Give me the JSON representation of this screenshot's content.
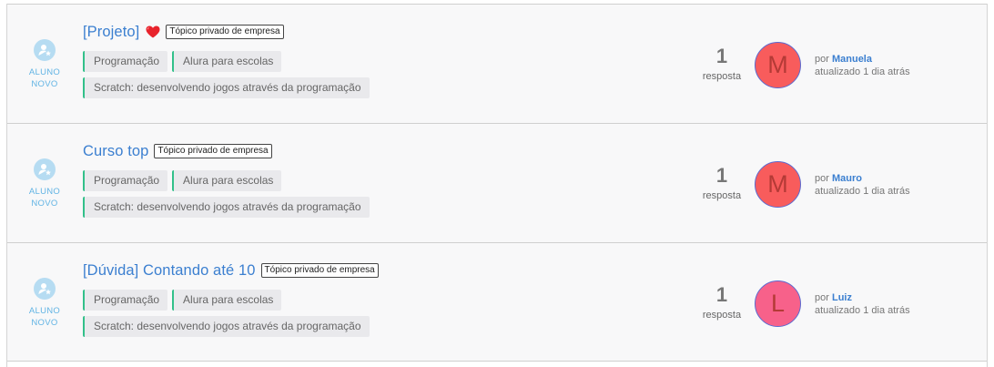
{
  "topics": [
    {
      "title": "[Projeto]",
      "has_heart": true,
      "badge": "Tópico privado de empresa",
      "author_type": [
        "ALUNO",
        "NOVO"
      ],
      "tags_row1": [
        "Programação",
        "Alura para escolas"
      ],
      "tags_row2": [
        "Scratch: desenvolvendo jogos através da programação"
      ],
      "reply_count": "1",
      "reply_label": "resposta",
      "avatar_letter": "M",
      "avatar_color": "#f85c5c",
      "by_label": "por",
      "user": "Manuela",
      "updated": "atualizado 1 dia atrás"
    },
    {
      "title": "Curso top",
      "has_heart": false,
      "badge": "Tópico privado de empresa",
      "author_type": [
        "ALUNO",
        "NOVO"
      ],
      "tags_row1": [
        "Programação",
        "Alura para escolas"
      ],
      "tags_row2": [
        "Scratch: desenvolvendo jogos através da programação"
      ],
      "reply_count": "1",
      "reply_label": "resposta",
      "avatar_letter": "M",
      "avatar_color": "#f85c5c",
      "by_label": "por",
      "user": "Mauro",
      "updated": "atualizado 1 dia atrás"
    },
    {
      "title": "[Dúvida] Contando até 10",
      "has_heart": false,
      "badge": "Tópico privado de empresa",
      "author_type": [
        "ALUNO",
        "NOVO"
      ],
      "tags_row1": [
        "Programação",
        "Alura para escolas"
      ],
      "tags_row2": [
        "Scratch: desenvolvendo jogos através da programação"
      ],
      "reply_count": "1",
      "reply_label": "resposta",
      "avatar_letter": "L",
      "avatar_color": "#f7618a",
      "by_label": "por",
      "user": "Luiz",
      "updated": "atualizado 1 dia atrás"
    }
  ],
  "colors": {
    "link": "#3b7fd0",
    "tag_accent": "#32c08a",
    "author_label": "#62b4e4"
  },
  "icons": {
    "author": "new-student-icon",
    "favorite": "heart-icon"
  }
}
